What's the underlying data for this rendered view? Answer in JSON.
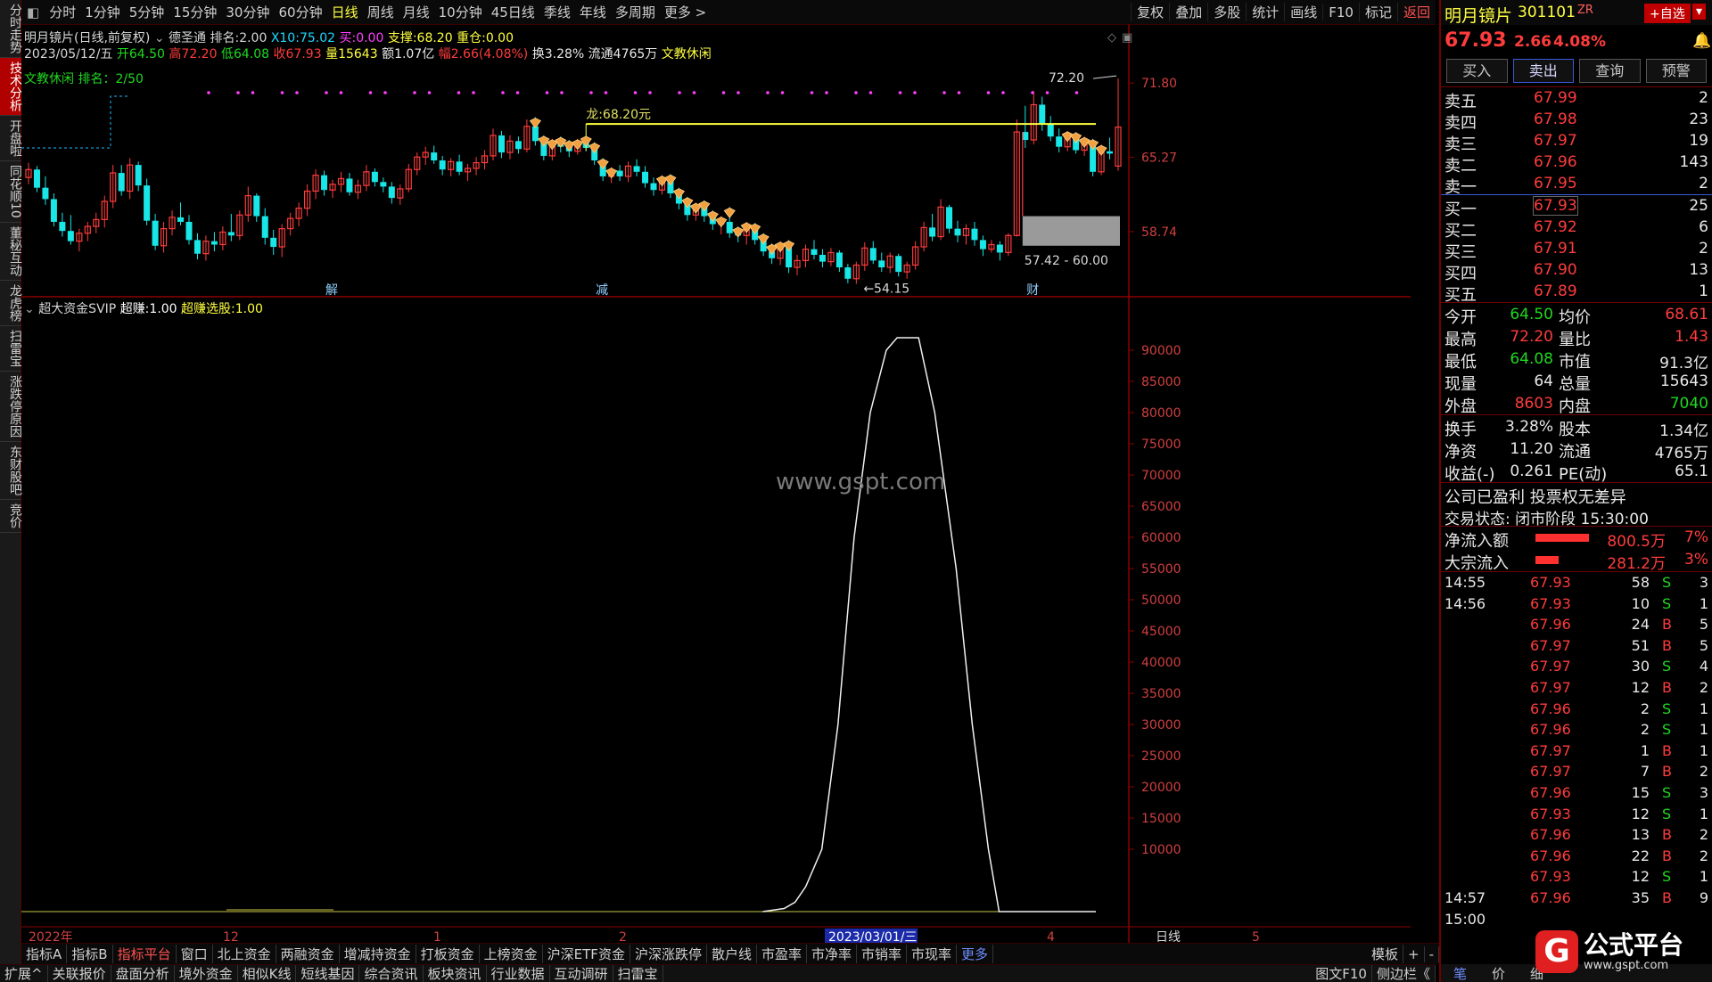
{
  "left_tabs": [
    "分时走势",
    "技术分析",
    "开盘啦",
    "同花顺10",
    "董秘互动",
    "龙虎榜",
    "扫雷宝",
    "涨跌停原因",
    "东财股吧",
    "竞价"
  ],
  "left_tab_active": 1,
  "period_tabs": [
    "分时",
    "1分钟",
    "5分钟",
    "15分钟",
    "30分钟",
    "60分钟",
    "日线",
    "周线",
    "月线",
    "10分钟",
    "45日线",
    "季线",
    "年线",
    "多周期",
    "更多 >"
  ],
  "period_active": 6,
  "toolbar": [
    "复权",
    "叠加",
    "多股",
    "统计",
    "画线",
    "F10",
    "标记",
    "返回"
  ],
  "info": {
    "title": "明月镜片(日线,前复权)",
    "indicator": "德圣通",
    "rank_label": "排名:",
    "rank_val": "2.00",
    "x10_label": "X10:",
    "x10_val": "75.02",
    "buy_label": "买:",
    "buy_val": "0.00",
    "support_label": "支撑:",
    "support_val": "68.20",
    "heavy_label": "重仓:",
    "heavy_val": "0.00",
    "date": "2023/05/12/五",
    "open_label": "开",
    "open_val": "64.50",
    "high_label": "高",
    "high_val": "72.20",
    "low_label": "低",
    "low_val": "64.08",
    "close_label": "收",
    "close_val": "67.93",
    "vol_label": "量",
    "vol_val": "15643",
    "amt_label": "额",
    "amt_val": "1.07亿",
    "chg_label": "幅",
    "chg_val": "2.66(4.08%)",
    "turn_label": "换",
    "turn_val": "3.28%",
    "float_label": "流通",
    "float_val": "4765万",
    "sector": "文教休闲",
    "sector_rank": "文教休闲 排名：2/50"
  },
  "main_annotations": {
    "dragon": "龙:68.20元",
    "high_mark": "72.20",
    "range": "57.42 - 60.00",
    "low_mark": "54.15",
    "markers": [
      "解",
      "减",
      "财"
    ]
  },
  "price_axis": [
    "71.80",
    "65.27",
    "58.74"
  ],
  "indicator_line": {
    "name": "超大资金SVIP",
    "f1_label": "超赚:",
    "f1_val": "1.00",
    "f2_label": "超赚选股:",
    "f2_val": "1.00"
  },
  "ind_axis": [
    "90000",
    "85000",
    "80000",
    "75000",
    "70000",
    "65000",
    "60000",
    "55000",
    "50000",
    "45000",
    "40000",
    "35000",
    "30000",
    "25000",
    "20000",
    "15000",
    "10000"
  ],
  "date_axis": [
    "2022年",
    "12",
    "1",
    "2",
    "2023/03/01/三",
    "4",
    "5"
  ],
  "axis_right_label": "日线",
  "watermark": "www.gspt.com",
  "bottom_tabs": [
    "指标A",
    "指标B",
    "指标平台",
    "窗口",
    "北上资金",
    "两融资金",
    "增减持资金",
    "打板资金",
    "上榜资金",
    "沪深ETF资金",
    "沪深涨跌停",
    "散户线",
    "市盈率",
    "市净率",
    "市销率",
    "市现率",
    "更多"
  ],
  "bottom_right": [
    "模板",
    "+",
    "-"
  ],
  "status_tabs": [
    "扩展^",
    "关联报价",
    "盘面分析",
    "境外资金",
    "相似K线",
    "短线基因",
    "综合资讯",
    "板块资讯",
    "行业数据",
    "互动调研",
    "扫雷宝"
  ],
  "status_right": [
    "图文F10",
    "侧边栏《"
  ],
  "quote": {
    "name": "明月镜片",
    "code": "301101",
    "flag": "ZR",
    "add_btn": "+自选",
    "price": "67.93",
    "change": "2.66",
    "pct": "4.08%",
    "buttons": [
      "买入",
      "卖出",
      "查询",
      "预警"
    ],
    "asks": [
      {
        "label": "卖五",
        "price": "67.99",
        "vol": "2"
      },
      {
        "label": "卖四",
        "price": "67.98",
        "vol": "23"
      },
      {
        "label": "卖三",
        "price": "67.97",
        "vol": "19"
      },
      {
        "label": "卖二",
        "price": "67.96",
        "vol": "143"
      },
      {
        "label": "卖一",
        "price": "67.95",
        "vol": "2"
      }
    ],
    "bids": [
      {
        "label": "买一",
        "price": "67.93",
        "vol": "25"
      },
      {
        "label": "买二",
        "price": "67.92",
        "vol": "6"
      },
      {
        "label": "买三",
        "price": "67.91",
        "vol": "2"
      },
      {
        "label": "买四",
        "price": "67.90",
        "vol": "13"
      },
      {
        "label": "买五",
        "price": "67.89",
        "vol": "1"
      }
    ],
    "stats": [
      {
        "l1": "今开",
        "v1": "64.50",
        "c1": "green",
        "l2": "均价",
        "v2": "68.61",
        "c2": "red"
      },
      {
        "l1": "最高",
        "v1": "72.20",
        "c1": "red",
        "l2": "量比",
        "v2": "1.43",
        "c2": "red"
      },
      {
        "l1": "最低",
        "v1": "64.08",
        "c1": "green",
        "l2": "市值",
        "v2": "91.3亿",
        "c2": "white"
      },
      {
        "l1": "现量",
        "v1": "64",
        "c1": "white",
        "l2": "总量",
        "v2": "15643",
        "c2": "white"
      },
      {
        "l1": "外盘",
        "v1": "8603",
        "c1": "red",
        "l2": "内盘",
        "v2": "7040",
        "c2": "green"
      }
    ],
    "stats2": [
      {
        "l1": "换手",
        "v1": "3.28%",
        "l2": "股本",
        "v2": "1.34亿"
      },
      {
        "l1": "净资",
        "v1": "11.20",
        "l2": "流通",
        "v2": "4765万"
      },
      {
        "l1": "收益(-)",
        "v1": "0.261",
        "l2": "PE(动)",
        "v2": "65.1"
      }
    ],
    "notice": "公司已盈利 投票权无差异",
    "trade_state": "交易状态: 闭市阶段 15:30:00",
    "flows": [
      {
        "label": "净流入额",
        "val": "800.5万",
        "pct": "7%",
        "frac": 0.7
      },
      {
        "label": "大宗流入",
        "val": "281.2万",
        "pct": "3%",
        "frac": 0.3
      }
    ],
    "ticks": [
      {
        "t": "14:55",
        "p": "67.93",
        "v": "58",
        "s": "S",
        "n": "3"
      },
      {
        "t": "14:56",
        "p": "67.93",
        "v": "10",
        "s": "S",
        "n": "1"
      },
      {
        "t": "",
        "p": "67.96",
        "v": "24",
        "s": "B",
        "n": "5"
      },
      {
        "t": "",
        "p": "67.97",
        "v": "51",
        "s": "B",
        "n": "5"
      },
      {
        "t": "",
        "p": "67.97",
        "v": "30",
        "s": "S",
        "n": "4"
      },
      {
        "t": "",
        "p": "67.97",
        "v": "12",
        "s": "B",
        "n": "2"
      },
      {
        "t": "",
        "p": "67.96",
        "v": "2",
        "s": "S",
        "n": "1"
      },
      {
        "t": "",
        "p": "67.96",
        "v": "2",
        "s": "S",
        "n": "1"
      },
      {
        "t": "",
        "p": "67.97",
        "v": "1",
        "s": "B",
        "n": "1"
      },
      {
        "t": "",
        "p": "67.97",
        "v": "7",
        "s": "B",
        "n": "2"
      },
      {
        "t": "",
        "p": "67.96",
        "v": "15",
        "s": "S",
        "n": "3"
      },
      {
        "t": "",
        "p": "67.93",
        "v": "12",
        "s": "S",
        "n": "1"
      },
      {
        "t": "",
        "p": "67.96",
        "v": "13",
        "s": "B",
        "n": "2"
      },
      {
        "t": "",
        "p": "67.96",
        "v": "22",
        "s": "B",
        "n": "2"
      },
      {
        "t": "",
        "p": "67.93",
        "v": "12",
        "s": "S",
        "n": "1"
      },
      {
        "t": "14:57",
        "p": "67.96",
        "v": "35",
        "s": "B",
        "n": "9"
      },
      {
        "t": "15:00",
        "p": "",
        "v": "",
        "s": "",
        "n": ""
      }
    ],
    "bottom_tabs": [
      "笔",
      "价",
      "细"
    ],
    "logo_main": "公式平台",
    "logo_sub": "www.gspt.com",
    "logo_icon": "G"
  },
  "chart_data": {
    "type": "candlestick",
    "colors": {
      "up": "#ff3c3c",
      "down": "#19e6e6",
      "support": "#ffff40"
    },
    "price_ticks": [
      71.8,
      65.27,
      58.74
    ],
    "support_price": 68.2,
    "candles": [
      [
        63.5,
        64.8,
        62.9,
        64.2
      ],
      [
        64.2,
        64.5,
        62.2,
        62.6
      ],
      [
        62.6,
        63.6,
        61.1,
        61.6
      ],
      [
        61.6,
        62.1,
        59.2,
        59.6
      ],
      [
        59.6,
        60.4,
        58.3,
        58.8
      ],
      [
        58.8,
        60.2,
        57.6,
        57.9
      ],
      [
        57.9,
        59.0,
        57.0,
        58.6
      ],
      [
        58.6,
        59.6,
        57.9,
        59.2
      ],
      [
        59.2,
        60.4,
        58.6,
        59.8
      ],
      [
        59.8,
        61.9,
        59.1,
        61.4
      ],
      [
        61.4,
        64.6,
        60.8,
        63.9
      ],
      [
        63.9,
        64.6,
        61.9,
        62.3
      ],
      [
        62.3,
        65.2,
        61.6,
        64.6
      ],
      [
        64.6,
        64.9,
        62.3,
        62.8
      ],
      [
        62.8,
        63.4,
        59.3,
        59.7
      ],
      [
        59.7,
        60.3,
        57.1,
        57.5
      ],
      [
        57.5,
        59.6,
        56.9,
        59.0
      ],
      [
        59.0,
        60.6,
        58.4,
        60.0
      ],
      [
        60.0,
        61.3,
        59.3,
        59.6
      ],
      [
        59.6,
        60.2,
        57.6,
        58.0
      ],
      [
        58.0,
        58.6,
        56.3,
        56.8
      ],
      [
        56.8,
        58.4,
        56.2,
        57.9
      ],
      [
        57.9,
        58.7,
        57.0,
        57.6
      ],
      [
        57.6,
        59.2,
        57.1,
        58.7
      ],
      [
        58.7,
        60.3,
        57.9,
        58.4
      ],
      [
        58.4,
        60.6,
        58.0,
        60.2
      ],
      [
        60.2,
        62.7,
        59.6,
        61.9
      ],
      [
        61.9,
        62.1,
        59.6,
        60.1
      ],
      [
        60.1,
        60.8,
        57.6,
        58.2
      ],
      [
        58.2,
        58.9,
        56.7,
        57.4
      ],
      [
        57.4,
        59.4,
        56.5,
        59.0
      ],
      [
        59.0,
        60.4,
        58.4,
        59.9
      ],
      [
        59.9,
        61.3,
        59.2,
        60.8
      ],
      [
        60.8,
        62.9,
        60.1,
        62.3
      ],
      [
        62.3,
        64.2,
        61.6,
        63.7
      ],
      [
        63.7,
        64.1,
        61.9,
        62.4
      ],
      [
        62.4,
        63.3,
        61.7,
        62.9
      ],
      [
        62.9,
        64.0,
        62.2,
        63.4
      ],
      [
        63.4,
        63.9,
        61.9,
        62.2
      ],
      [
        62.2,
        63.3,
        61.6,
        62.8
      ],
      [
        62.8,
        64.6,
        62.3,
        64.0
      ],
      [
        64.0,
        64.3,
        62.7,
        63.1
      ],
      [
        63.1,
        63.5,
        62.2,
        62.7
      ],
      [
        62.7,
        63.1,
        61.2,
        61.7
      ],
      [
        61.7,
        62.9,
        61.1,
        62.5
      ],
      [
        62.5,
        64.7,
        62.2,
        64.2
      ],
      [
        64.2,
        65.7,
        63.7,
        65.3
      ],
      [
        65.3,
        66.2,
        64.6,
        65.7
      ],
      [
        65.7,
        66.3,
        64.7,
        65.0
      ],
      [
        65.0,
        65.4,
        63.7,
        64.2
      ],
      [
        64.2,
        65.2,
        63.6,
        64.9
      ],
      [
        64.9,
        65.5,
        63.7,
        64.0
      ],
      [
        64.0,
        64.7,
        63.2,
        64.3
      ],
      [
        64.3,
        65.3,
        63.7,
        64.8
      ],
      [
        64.8,
        65.9,
        64.2,
        65.4
      ],
      [
        65.4,
        67.8,
        65.0,
        67.2
      ],
      [
        67.2,
        67.6,
        65.2,
        65.7
      ],
      [
        65.7,
        67.2,
        65.1,
        66.7
      ],
      [
        66.7,
        67.1,
        65.6,
        66.0
      ],
      [
        66.0,
        68.6,
        65.7,
        68.0
      ],
      [
        68.0,
        68.8,
        66.3,
        66.7
      ],
      [
        66.7,
        67.2,
        65.0,
        65.4
      ],
      [
        65.4,
        66.9,
        65.0,
        66.4
      ],
      [
        66.4,
        67.1,
        65.7,
        66.2
      ],
      [
        66.2,
        66.8,
        65.3,
        65.8
      ],
      [
        65.8,
        66.9,
        65.5,
        66.5
      ],
      [
        66.5,
        67.2,
        65.8,
        66.1
      ],
      [
        66.1,
        66.6,
        64.6,
        65.0
      ],
      [
        65.0,
        65.2,
        63.2,
        63.6
      ],
      [
        63.6,
        64.4,
        63.0,
        64.1
      ],
      [
        64.1,
        64.6,
        63.2,
        63.6
      ],
      [
        63.6,
        64.9,
        63.1,
        64.5
      ],
      [
        64.5,
        65.1,
        63.6,
        64.0
      ],
      [
        64.0,
        64.5,
        62.6,
        63.0
      ],
      [
        63.0,
        63.5,
        61.9,
        62.4
      ],
      [
        62.4,
        63.7,
        62.0,
        63.4
      ],
      [
        63.4,
        63.8,
        61.7,
        62.1
      ],
      [
        62.1,
        62.6,
        60.7,
        61.2
      ],
      [
        61.2,
        61.8,
        59.7,
        60.2
      ],
      [
        60.2,
        61.3,
        59.7,
        60.9
      ],
      [
        60.9,
        61.5,
        59.6,
        60.1
      ],
      [
        60.1,
        60.6,
        58.9,
        59.4
      ],
      [
        59.4,
        60.1,
        58.5,
        59.6
      ],
      [
        59.6,
        60.9,
        58.2,
        58.6
      ],
      [
        58.6,
        59.2,
        57.8,
        58.4
      ],
      [
        58.4,
        59.6,
        57.6,
        59.2
      ],
      [
        59.2,
        59.5,
        57.6,
        58.0
      ],
      [
        58.0,
        58.6,
        56.6,
        57.0
      ],
      [
        57.0,
        57.7,
        55.9,
        56.4
      ],
      [
        56.4,
        57.9,
        55.8,
        57.5
      ],
      [
        57.5,
        58.0,
        55.1,
        55.6
      ],
      [
        55.6,
        56.7,
        54.9,
        56.2
      ],
      [
        56.2,
        57.6,
        55.6,
        57.2
      ],
      [
        57.2,
        58.0,
        56.3,
        56.7
      ],
      [
        56.7,
        57.2,
        55.6,
        56.1
      ],
      [
        56.1,
        57.3,
        55.7,
        56.9
      ],
      [
        56.9,
        57.1,
        55.2,
        55.6
      ],
      [
        55.6,
        55.9,
        54.2,
        54.6
      ],
      [
        54.6,
        56.1,
        54.15,
        55.8
      ],
      [
        55.8,
        57.8,
        55.3,
        57.3
      ],
      [
        57.3,
        57.9,
        55.9,
        56.2
      ],
      [
        56.2,
        56.9,
        55.2,
        55.6
      ],
      [
        55.6,
        56.9,
        55.1,
        56.6
      ],
      [
        56.6,
        56.8,
        54.8,
        55.2
      ],
      [
        55.2,
        56.1,
        54.6,
        55.8
      ],
      [
        55.8,
        57.9,
        55.4,
        57.4
      ],
      [
        57.4,
        59.6,
        57.0,
        59.1
      ],
      [
        59.1,
        60.3,
        57.9,
        58.3
      ],
      [
        58.3,
        61.6,
        58.0,
        60.9
      ],
      [
        60.9,
        61.1,
        58.6,
        59.0
      ],
      [
        59.0,
        59.7,
        57.8,
        58.4
      ],
      [
        58.4,
        59.4,
        57.6,
        59.0
      ],
      [
        59.0,
        59.6,
        57.5,
        58.0
      ],
      [
        58.0,
        58.4,
        56.6,
        57.2
      ],
      [
        57.2,
        58.0,
        56.9,
        57.6
      ],
      [
        57.6,
        57.9,
        56.2,
        56.9
      ],
      [
        56.9,
        58.6,
        56.6,
        58.4
      ],
      [
        58.4,
        68.6,
        58.3,
        67.5
      ],
      [
        67.5,
        69.8,
        66.1,
        66.8
      ],
      [
        66.8,
        71.1,
        66.4,
        69.9
      ],
      [
        69.9,
        70.6,
        67.6,
        68.2
      ],
      [
        68.2,
        68.9,
        66.7,
        67.1
      ],
      [
        67.1,
        67.8,
        65.7,
        66.2
      ],
      [
        66.2,
        67.6,
        65.8,
        67.2
      ],
      [
        67.2,
        67.5,
        65.6,
        65.9
      ],
      [
        65.9,
        67.1,
        65.4,
        66.6
      ],
      [
        66.6,
        66.9,
        63.6,
        64.0
      ],
      [
        64.0,
        66.4,
        63.7,
        65.8
      ],
      [
        65.8,
        67.0,
        65.1,
        65.6
      ],
      [
        64.5,
        72.2,
        64.08,
        67.93
      ]
    ],
    "indicator_series": [
      {
        "name": "超大资金SVIP",
        "points": [
          [
            0.69,
            0
          ],
          [
            0.71,
            500
          ],
          [
            0.72,
            1500
          ],
          [
            0.73,
            4000
          ],
          [
            0.745,
            10000
          ],
          [
            0.76,
            30000
          ],
          [
            0.775,
            60000
          ],
          [
            0.79,
            80000
          ],
          [
            0.805,
            90000
          ],
          [
            0.815,
            92000
          ],
          [
            0.835,
            92000
          ],
          [
            0.85,
            80000
          ],
          [
            0.87,
            55000
          ],
          [
            0.885,
            30000
          ],
          [
            0.9,
            10000
          ],
          [
            0.91,
            0
          ],
          [
            1.0,
            0
          ]
        ]
      }
    ],
    "indicator_ticks": [
      90000,
      85000,
      80000,
      75000,
      70000,
      65000,
      60000,
      55000,
      50000,
      45000,
      40000,
      35000,
      30000,
      25000,
      20000,
      15000,
      10000
    ]
  }
}
